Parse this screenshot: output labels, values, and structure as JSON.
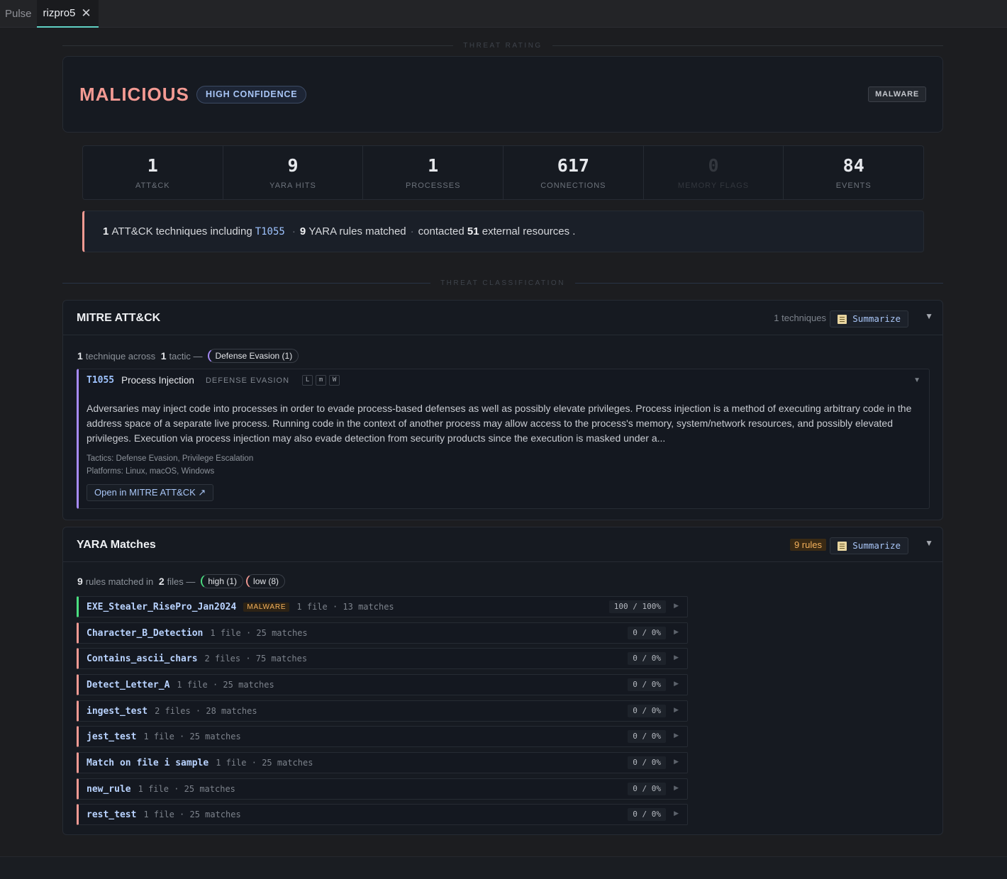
{
  "tabs": [
    {
      "label": "Pulse"
    },
    {
      "label": "rizpro5"
    }
  ],
  "sections": {
    "threat_rating": "THREAT RATING",
    "threat_classification": "THREAT CLASSIFICATION"
  },
  "rating": {
    "verdict": "MALICIOUS",
    "confidence": "HIGH CONFIDENCE",
    "category": "MALWARE"
  },
  "stats": [
    {
      "value": "1",
      "label": "ATT&CK"
    },
    {
      "value": "9",
      "label": "YARA HITS"
    },
    {
      "value": "1",
      "label": "PROCESSES"
    },
    {
      "value": "617",
      "label": "CONNECTIONS"
    },
    {
      "value": "0",
      "label": "MEMORY FLAGS"
    },
    {
      "value": "84",
      "label": "EVENTS"
    }
  ],
  "summary": {
    "tech_count": "1",
    "tech_text": "ATT&CK techniques including",
    "tech_id": "T1055",
    "yara_count": "9",
    "yara_text": "YARA rules matched",
    "contacted_text": "contacted",
    "resource_count": "51",
    "resource_text": "external resources ."
  },
  "mitre": {
    "title": "MITRE ATT&CK",
    "count_text": "1 techniques",
    "summarize": "Summarize",
    "crumb": {
      "n1": "1",
      "t1": "technique across",
      "n2": "1",
      "t2": "tactic —",
      "tactic_pill": "Defense Evasion (1)"
    },
    "technique": {
      "id": "T1055",
      "name": "Process Injection",
      "tactic": "DEFENSE EVASION",
      "platforms": [
        "L",
        "m",
        "W"
      ],
      "description": "Adversaries may inject code into processes in order to evade process-based defenses as well as possibly elevate privileges. Process injection is a method of executing arbitrary code in the address space of a separate live process. Running code in the context of another process may allow access to the process's memory, system/network resources, and possibly elevated privileges. Execution via process injection may also evade detection from security products since the execution is masked under a...",
      "tactics_line": "Tactics: Defense Evasion, Privilege Escalation",
      "platforms_line": "Platforms: Linux, macOS, Windows",
      "open_link": "Open in MITRE ATT&CK ↗"
    }
  },
  "yara": {
    "title": "YARA Matches",
    "rules_badge": "9 rules",
    "summarize": "Summarize",
    "crumb": {
      "n1": "9",
      "t1": "rules matched in",
      "n2": "2",
      "t2": "files —",
      "high_pill": "high (1)",
      "low_pill": "low (8)"
    },
    "rules": [
      {
        "name": "EXE_Stealer_RisePro_Jan2024",
        "tag": "MALWARE",
        "meta": "1 file · 13 matches",
        "score": "100 / 100%"
      },
      {
        "name": "Character_B_Detection",
        "tag": "",
        "meta": "1 file · 25 matches",
        "score": "0 / 0%"
      },
      {
        "name": "Contains_ascii_chars",
        "tag": "",
        "meta": "2 files · 75 matches",
        "score": "0 / 0%"
      },
      {
        "name": "Detect_Letter_A",
        "tag": "",
        "meta": "1 file · 25 matches",
        "score": "0 / 0%"
      },
      {
        "name": "ingest_test",
        "tag": "",
        "meta": "2 files · 28 matches",
        "score": "0 / 0%"
      },
      {
        "name": "jest_test",
        "tag": "",
        "meta": "1 file · 25 matches",
        "score": "0 / 0%"
      },
      {
        "name": "Match on file i sample",
        "tag": "",
        "meta": "1 file · 25 matches",
        "score": "0 / 0%"
      },
      {
        "name": "new_rule",
        "tag": "",
        "meta": "1 file · 25 matches",
        "score": "0 / 0%"
      },
      {
        "name": "rest_test",
        "tag": "",
        "meta": "1 file · 25 matches",
        "score": "0 / 0%"
      }
    ]
  },
  "colors": {
    "verdict": "#f39a93",
    "accent_link": "#9ec3ff",
    "tactic_purple": "#a78bfa",
    "high_green": "#4ade80",
    "tab_underline": "#5fd0c3"
  }
}
